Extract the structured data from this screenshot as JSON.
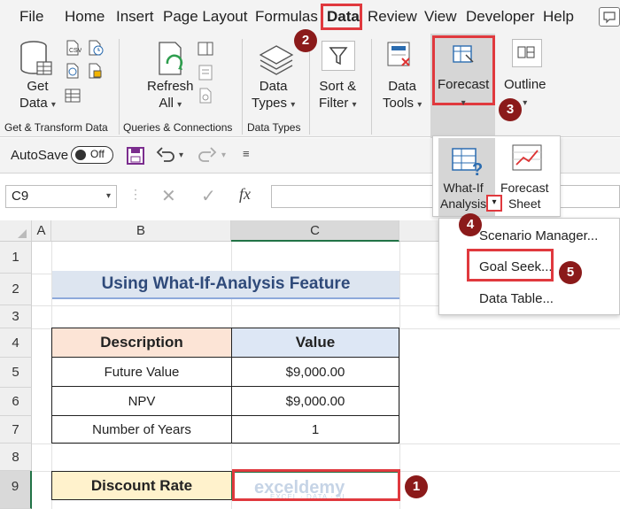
{
  "menubar": {
    "tabs": [
      "File",
      "Home",
      "Insert",
      "Page Layout",
      "Formulas",
      "Data",
      "Review",
      "View",
      "Developer",
      "Help"
    ]
  },
  "ribbon": {
    "get_data": "Get",
    "get_data2": "Data",
    "refresh": "Refresh",
    "refresh2": "All",
    "data_types": "Data",
    "data_types2": "Types",
    "sort_filter": "Sort &",
    "sort_filter2": "Filter",
    "data_tools": "Data",
    "data_tools2": "Tools",
    "forecast": "Forecast",
    "outline": "Outline",
    "groups": {
      "get_transform": "Get & Transform Data",
      "queries": "Queries & Connections",
      "data_types": "Data Types"
    }
  },
  "qat": {
    "autosave_label": "AutoSave",
    "autosave_state": "Off"
  },
  "formula_bar": {
    "name_box": "C9",
    "fx": "fx",
    "value": ""
  },
  "whatif_panel": {
    "whatif_line1": "What-If",
    "whatif_line2": "Analysis",
    "forecast_line1": "Forecast",
    "forecast_line2": "Sheet"
  },
  "whatif_menu": {
    "items": [
      "Scenario Manager...",
      "Goal Seek...",
      "Data Table..."
    ]
  },
  "grid": {
    "columns": [
      "A",
      "B",
      "C"
    ],
    "rows": [
      "1",
      "2",
      "3",
      "4",
      "5",
      "6",
      "7",
      "8",
      "9"
    ],
    "title": "Using What-If-Analysis Feature",
    "headers": {
      "description": "Description",
      "value": "Value"
    },
    "table": [
      {
        "label": "Future Value",
        "value": "$9,000.00"
      },
      {
        "label": "NPV",
        "value": "$9,000.00"
      },
      {
        "label": "Number of Years",
        "value": "1"
      }
    ],
    "discount_label": "Discount Rate",
    "discount_value": "",
    "watermark": "exceldemy",
    "watermark_sub": "EXCEL · DATA · BI"
  },
  "badges": [
    "1",
    "2",
    "3",
    "4",
    "5"
  ],
  "colors": {
    "accent": "#217346",
    "highlight": "#e0393e",
    "badge": "#8b1a1a",
    "header_desc": "#fce4d6",
    "header_value": "#dde7f5",
    "discount_fill": "#fff2cc",
    "title_fill": "#dde5f0",
    "title_text": "#2f4a7a"
  }
}
